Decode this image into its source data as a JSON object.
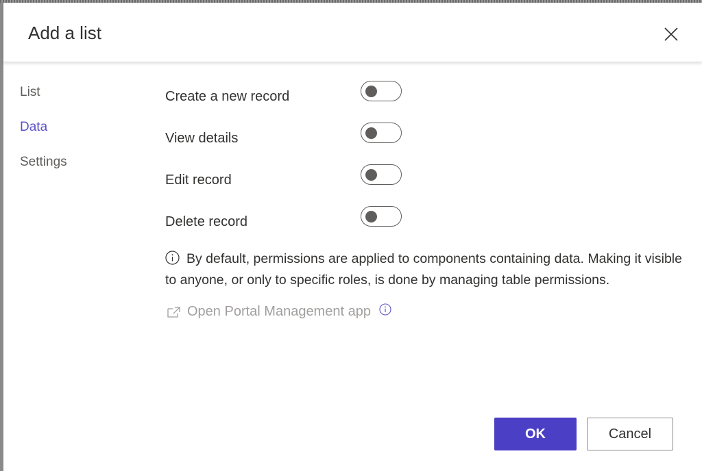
{
  "dialog": {
    "title": "Add a list"
  },
  "nav": {
    "items": [
      {
        "label": "List"
      },
      {
        "label": "Data"
      },
      {
        "label": "Settings"
      }
    ],
    "active": "Data"
  },
  "toggles": [
    {
      "label": "Create a new record",
      "on": false
    },
    {
      "label": "View details",
      "on": false
    },
    {
      "label": "Edit record",
      "on": false
    },
    {
      "label": "Delete record",
      "on": false
    }
  ],
  "info": {
    "text": "By default, permissions are applied to components containing data. Making it visible to anyone, or only to specific roles, is done by managing table permissions."
  },
  "portal_link": {
    "label": "Open Portal Management app"
  },
  "footer": {
    "ok_label": "OK",
    "cancel_label": "Cancel"
  },
  "colors": {
    "accent": "#4a3fc5",
    "nav_active": "#5b52c9",
    "disabled_link": "#a19f9d"
  },
  "icons": {
    "close": "close-icon",
    "info": "info-icon",
    "external": "external-link-icon"
  }
}
